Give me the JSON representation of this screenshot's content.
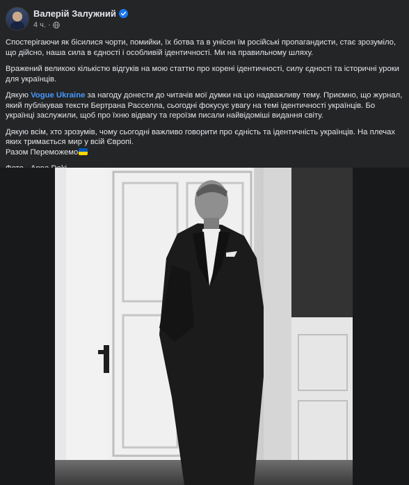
{
  "post": {
    "author": "Валерій Залужний",
    "time": "4 ч.",
    "separator": "·",
    "paragraphs": {
      "p1": "Спостерігаючи як бісилися чорти, помийки, їх ботва та в унісон їм російські пропагандисти, стає зрозуміло, що дійсно, наша сила в єдності і особливій ідентичності. Ми на правильному шляху.",
      "p2": "Вражений великою кількістю відгуків на мою статтю про корені ідентичності, силу єдності та історичні уроки для українців.",
      "p3_before": "Дякую ",
      "p3_link": "Vogue Ukraine",
      "p3_after": " за нагоду донести до читачів мої думки на цю надважливу тему. Приємно, що журнал, який публікував тексти Бертрана Расселла, сьогодні фокусує увагу на темі ідентичності українців. Бо українці заслужили, щоб про їхню відвагу та героїзм писали найвідоміші видання світу.",
      "p4_line1": "Дякую всім, хто зрозумів, чому сьогодні важливо говорити про єдність та ідентичність українців. На плечах яких тримається мир у всій Європі.",
      "p4_line2": "Разом Переможемо",
      "p5": "Фото - Anna Daki"
    }
  },
  "colors": {
    "background": "#242526",
    "text": "#e4e6eb",
    "secondary_text": "#b0b3b8",
    "link": "#4599ff",
    "verified": "#1877f2",
    "flag_blue": "#0057b7",
    "flag_yellow": "#ffd700"
  },
  "icons": {
    "verified": "verified-badge-icon",
    "globe": "globe-icon",
    "flag": "ukraine-flag-emoji"
  }
}
